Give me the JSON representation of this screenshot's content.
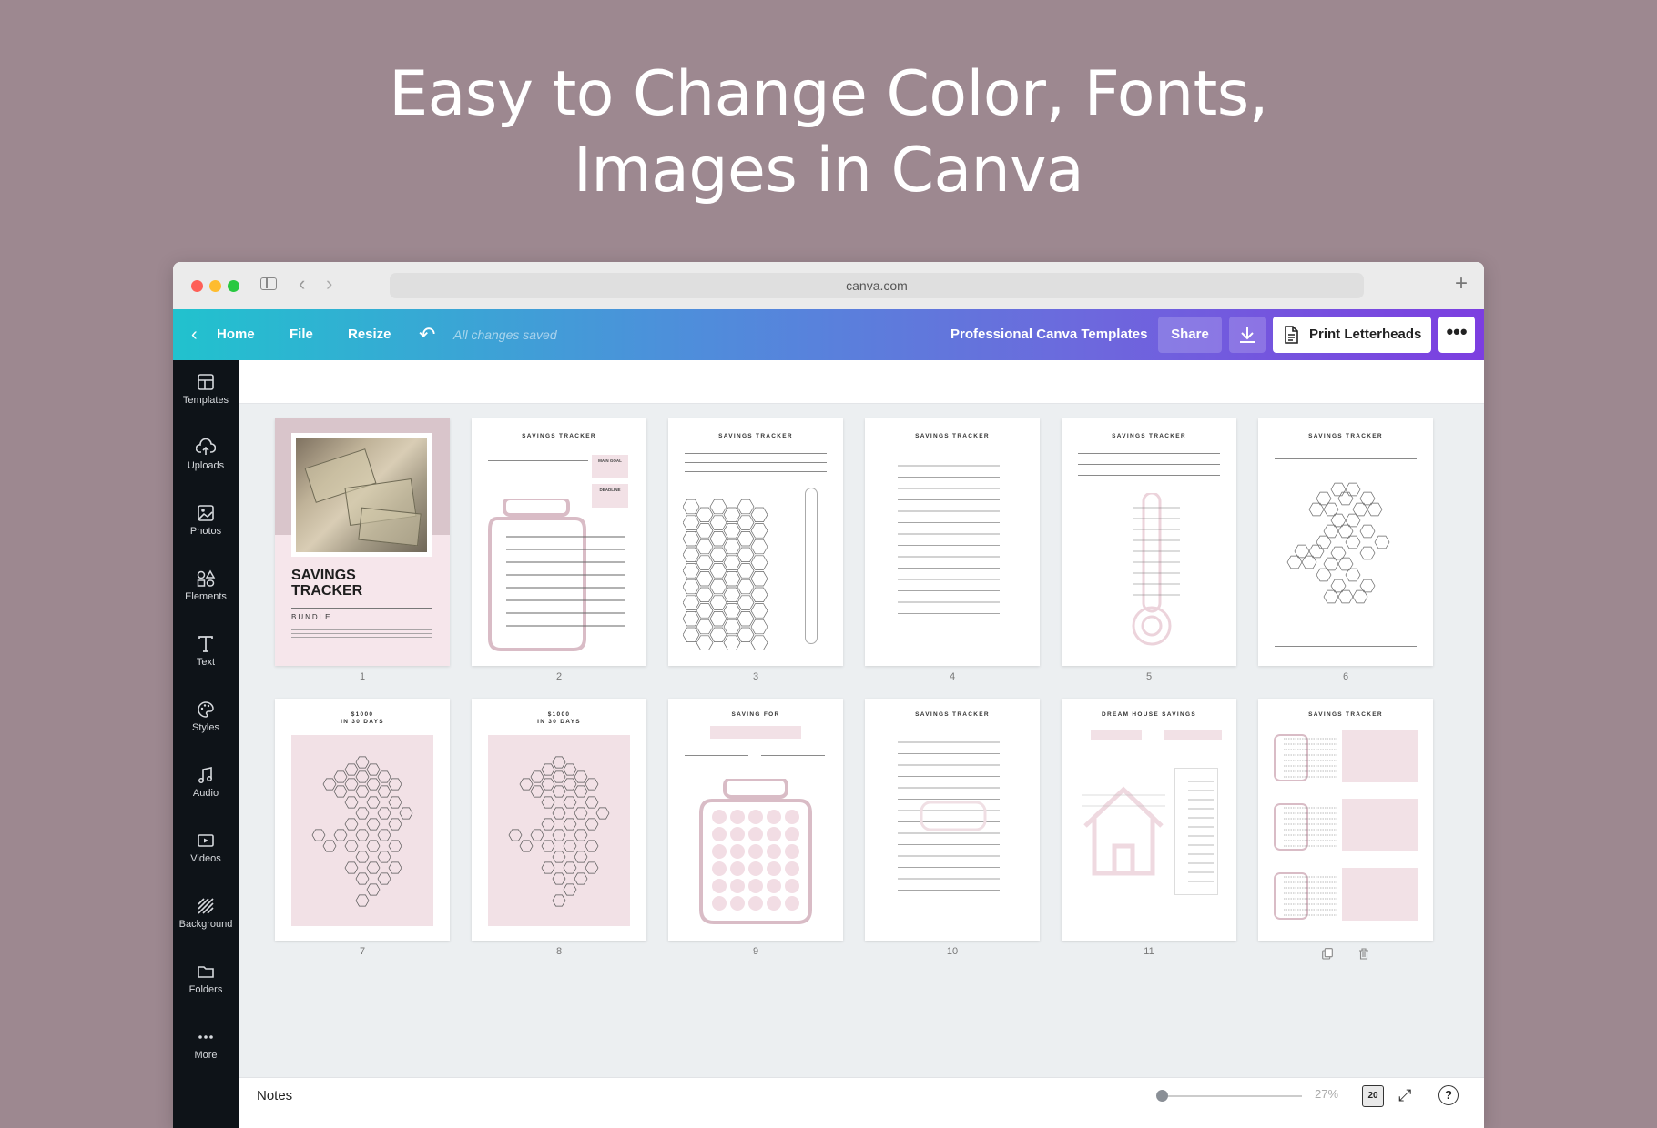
{
  "headline": {
    "line1": "Easy to Change Color, Fonts,",
    "line2": "Images in Canva"
  },
  "browser": {
    "url": "canva.com",
    "back_icon": "chevron-left-icon",
    "forward_icon": "chevron-right-icon",
    "new_tab_icon": "plus-icon"
  },
  "toolbar": {
    "home": "Home",
    "file": "File",
    "resize": "Resize",
    "status": "All changes saved",
    "project_title": "Professional Canva Templates",
    "share": "Share",
    "print": "Print Letterheads",
    "more": "•••",
    "gradient": [
      "#21c2ce",
      "#7c3ee0"
    ]
  },
  "sidebar": {
    "items": [
      {
        "label": "Templates",
        "icon": "layout-icon"
      },
      {
        "label": "Uploads",
        "icon": "cloud-upload-icon"
      },
      {
        "label": "Photos",
        "icon": "image-icon"
      },
      {
        "label": "Elements",
        "icon": "shapes-icon"
      },
      {
        "label": "Text",
        "icon": "text-icon"
      },
      {
        "label": "Styles",
        "icon": "palette-icon"
      },
      {
        "label": "Audio",
        "icon": "music-note-icon"
      },
      {
        "label": "Videos",
        "icon": "video-icon"
      },
      {
        "label": "Background",
        "icon": "background-hatch-icon"
      },
      {
        "label": "Folders",
        "icon": "folder-icon"
      },
      {
        "label": "More",
        "icon": "more-dots-icon"
      }
    ]
  },
  "pages": [
    {
      "num": "1",
      "title": "SAVINGS TRACKER",
      "subtitle": "BUNDLE",
      "kind": "cover"
    },
    {
      "num": "2",
      "title": "SAVINGS TRACKER",
      "kind": "jar-lines",
      "labels": [
        "MAIN GOAL",
        "DEADLINE"
      ]
    },
    {
      "num": "3",
      "title": "SAVINGS TRACKER",
      "kind": "hex-thermo"
    },
    {
      "num": "4",
      "title": "SAVINGS TRACKER",
      "kind": "percent-lines"
    },
    {
      "num": "5",
      "title": "SAVINGS TRACKER",
      "kind": "thermometer"
    },
    {
      "num": "6",
      "title": "SAVINGS TRACKER",
      "kind": "hex-cluster"
    },
    {
      "num": "7",
      "title": "$1000\nIN 30 DAYS",
      "kind": "hex-pink"
    },
    {
      "num": "8",
      "title": "$1000\nIN 30 DAYS",
      "kind": "hex-pink"
    },
    {
      "num": "9",
      "title": "SAVING FOR",
      "kind": "jar-dots"
    },
    {
      "num": "10",
      "title": "SAVINGS TRACKER",
      "kind": "percent-lines"
    },
    {
      "num": "11",
      "title": "DREAM HOUSE SAVINGS",
      "kind": "house"
    },
    {
      "num": "",
      "title": "SAVINGS TRACKER",
      "kind": "mini-jars"
    }
  ],
  "page_actions": {
    "duplicate_icon": "duplicate-icon",
    "delete_icon": "trash-icon"
  },
  "bottombar": {
    "notes": "Notes",
    "zoom": "27%",
    "page_count": "20",
    "fullscreen_icon": "expand-icon",
    "help": "?"
  }
}
